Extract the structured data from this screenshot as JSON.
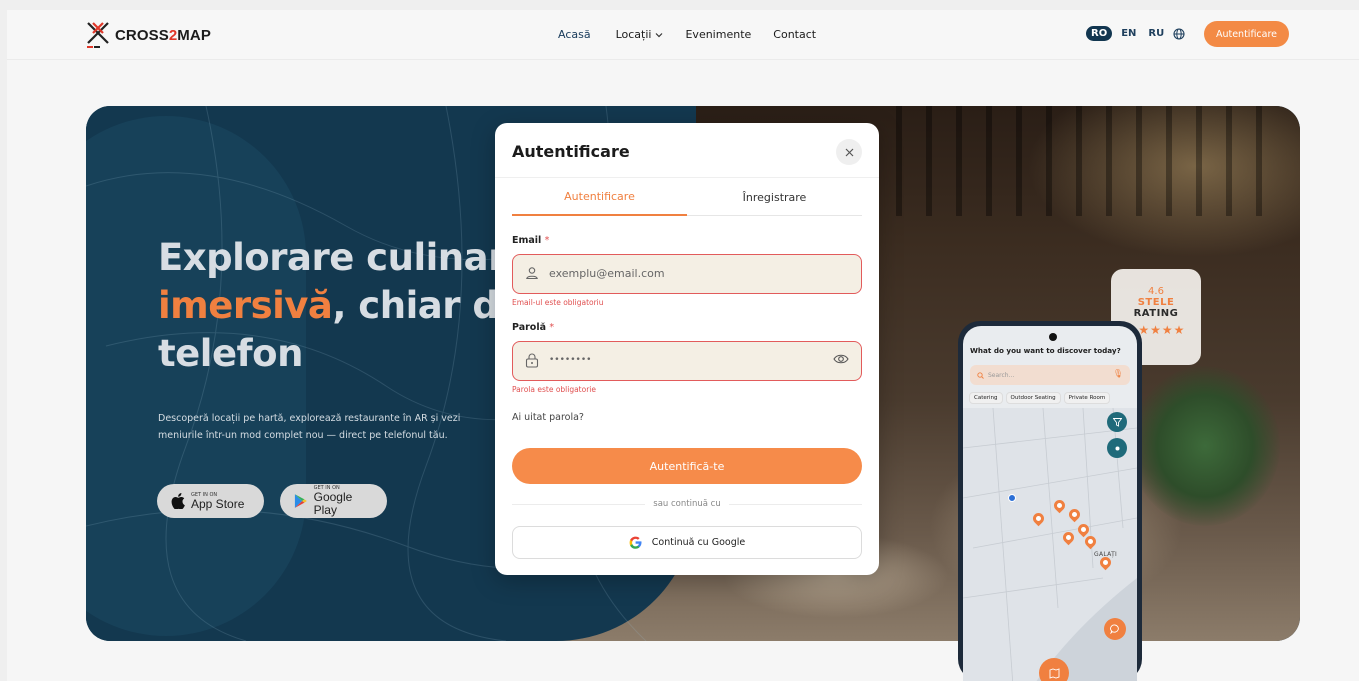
{
  "header": {
    "logo_text_a": "CROSS",
    "logo_text_b": "2",
    "logo_text_c": "MAP",
    "nav": [
      {
        "label": "Acasă"
      },
      {
        "label": "Locații"
      },
      {
        "label": "Evenimente"
      },
      {
        "label": "Contact"
      }
    ],
    "languages": [
      "RO",
      "EN",
      "RU"
    ],
    "selected_language": "RO",
    "auth_button": "Autentificare"
  },
  "hero": {
    "title_line1": "Explorare culinar",
    "title_line2_highlight": "imersivă",
    "title_line2_rest": ", chiar di",
    "title_line3": "telefon",
    "description": "Descoperă locații pe hartă, explorează restaurante în AR și vezi meniurile într-un mod complet nou — direct pe telefonul tău.",
    "app_store_small": "GET IN ON",
    "app_store_big": "App Store",
    "google_play_small": "GET IN ON",
    "google_play_big": "Google Play"
  },
  "rating_card": {
    "value": "4.6",
    "label1": "STELE",
    "label2": "RATING",
    "stars": "★★★★★"
  },
  "phone": {
    "title": "What do you want to discover today?",
    "search_placeholder": "Search...",
    "chips": [
      "Catering",
      "Outdoor Seating",
      "Private Room"
    ],
    "city_label": "GALAȚI"
  },
  "modal": {
    "title": "Autentificare",
    "tabs": [
      {
        "label": "Autentificare",
        "active": true
      },
      {
        "label": "Înregistrare",
        "active": false
      }
    ],
    "email_label": "Email",
    "required_mark": "*",
    "email_placeholder": "exemplu@email.com",
    "email_error": "Email-ul este obligatoriu",
    "password_label": "Parolă",
    "password_value": "••••••••",
    "password_error": "Parola este obligatorie",
    "forgot_password": "Ai uitat parola?",
    "submit": "Autentifică-te",
    "divider_text": "sau continuă cu",
    "google_button": "Continuă cu Google"
  },
  "colors": {
    "accent": "#f38a45",
    "navy": "#13384f",
    "error": "#e05050"
  }
}
